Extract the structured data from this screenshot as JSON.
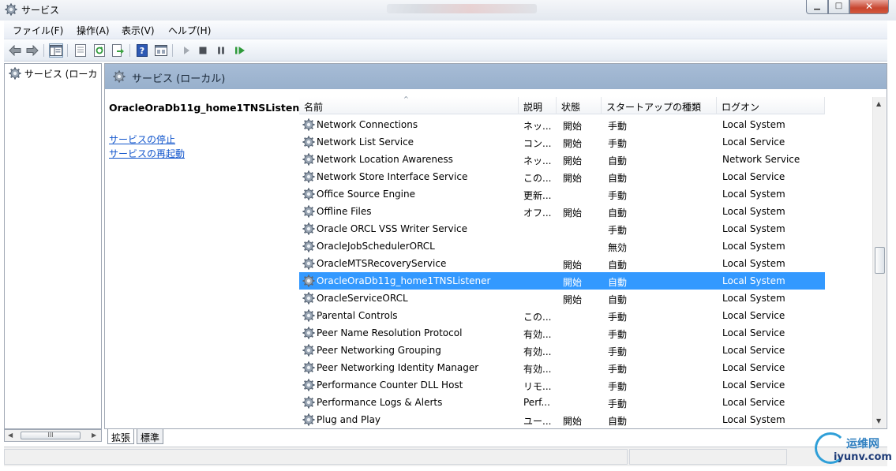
{
  "window": {
    "title": "サービス"
  },
  "menu": {
    "items": [
      "ファイル(F)",
      "操作(A)",
      "表示(V)",
      "ヘルプ(H)"
    ]
  },
  "toolbar": {
    "buttons": [
      "back-icon",
      "forward-icon",
      "show-hide-tree-icon",
      "properties-icon",
      "refresh-icon",
      "export-icon",
      "help-icon",
      "view-icon",
      "start-icon",
      "stop-icon",
      "pause-icon",
      "resume-icon"
    ]
  },
  "tree": {
    "root_label": "サービス (ローカ"
  },
  "main": {
    "header_title": "サービス (ローカル)",
    "selected_service": "OracleOraDb11g_home1TNSListener",
    "links": [
      "サービスの停止",
      "サービスの再起動"
    ]
  },
  "columns": [
    "名前",
    "説明",
    "状態",
    "スタートアップの種類",
    "ログオン"
  ],
  "services": [
    {
      "name": "Network Connections",
      "desc": "ネッ...",
      "status": "開始",
      "startup": "手動",
      "logon": "Local System"
    },
    {
      "name": "Network List Service",
      "desc": "コン...",
      "status": "開始",
      "startup": "手動",
      "logon": "Local Service"
    },
    {
      "name": "Network Location Awareness",
      "desc": "ネッ...",
      "status": "開始",
      "startup": "自動",
      "logon": "Network Service"
    },
    {
      "name": "Network Store Interface Service",
      "desc": "この...",
      "status": "開始",
      "startup": "自動",
      "logon": "Local Service"
    },
    {
      "name": "Office Source Engine",
      "desc": "更新...",
      "status": "",
      "startup": "手動",
      "logon": "Local System"
    },
    {
      "name": "Offline Files",
      "desc": "オフ...",
      "status": "開始",
      "startup": "自動",
      "logon": "Local System"
    },
    {
      "name": "Oracle ORCL VSS Writer Service",
      "desc": "",
      "status": "",
      "startup": "手動",
      "logon": "Local System"
    },
    {
      "name": "OracleJobSchedulerORCL",
      "desc": "",
      "status": "",
      "startup": "無効",
      "logon": "Local System"
    },
    {
      "name": "OracleMTSRecoveryService",
      "desc": "",
      "status": "開始",
      "startup": "自動",
      "logon": "Local System"
    },
    {
      "name": "OracleOraDb11g_home1TNSListener",
      "desc": "",
      "status": "開始",
      "startup": "自動",
      "logon": "Local System",
      "selected": true
    },
    {
      "name": "OracleServiceORCL",
      "desc": "",
      "status": "開始",
      "startup": "自動",
      "logon": "Local System"
    },
    {
      "name": "Parental Controls",
      "desc": "この...",
      "status": "",
      "startup": "手動",
      "logon": "Local Service"
    },
    {
      "name": "Peer Name Resolution Protocol",
      "desc": "有効...",
      "status": "",
      "startup": "手動",
      "logon": "Local Service"
    },
    {
      "name": "Peer Networking Grouping",
      "desc": "有効...",
      "status": "",
      "startup": "手動",
      "logon": "Local Service"
    },
    {
      "name": "Peer Networking Identity Manager",
      "desc": "有効...",
      "status": "",
      "startup": "手動",
      "logon": "Local Service"
    },
    {
      "name": "Performance Counter DLL Host",
      "desc": "リモ...",
      "status": "",
      "startup": "手動",
      "logon": "Local Service"
    },
    {
      "name": "Performance Logs & Alerts",
      "desc": "Perf...",
      "status": "",
      "startup": "手動",
      "logon": "Local Service"
    },
    {
      "name": "Plug and Play",
      "desc": "ユー...",
      "status": "開始",
      "startup": "自動",
      "logon": "Local System"
    }
  ],
  "tabs": [
    "拡張",
    "標準"
  ],
  "scrollbar": {
    "thumb_label": "III"
  },
  "watermark": {
    "cn": "运维网",
    "url": "iyunv.com"
  },
  "colors": {
    "selection": "#3399ff",
    "header": "#9fb6d2",
    "link": "#1155cc"
  }
}
